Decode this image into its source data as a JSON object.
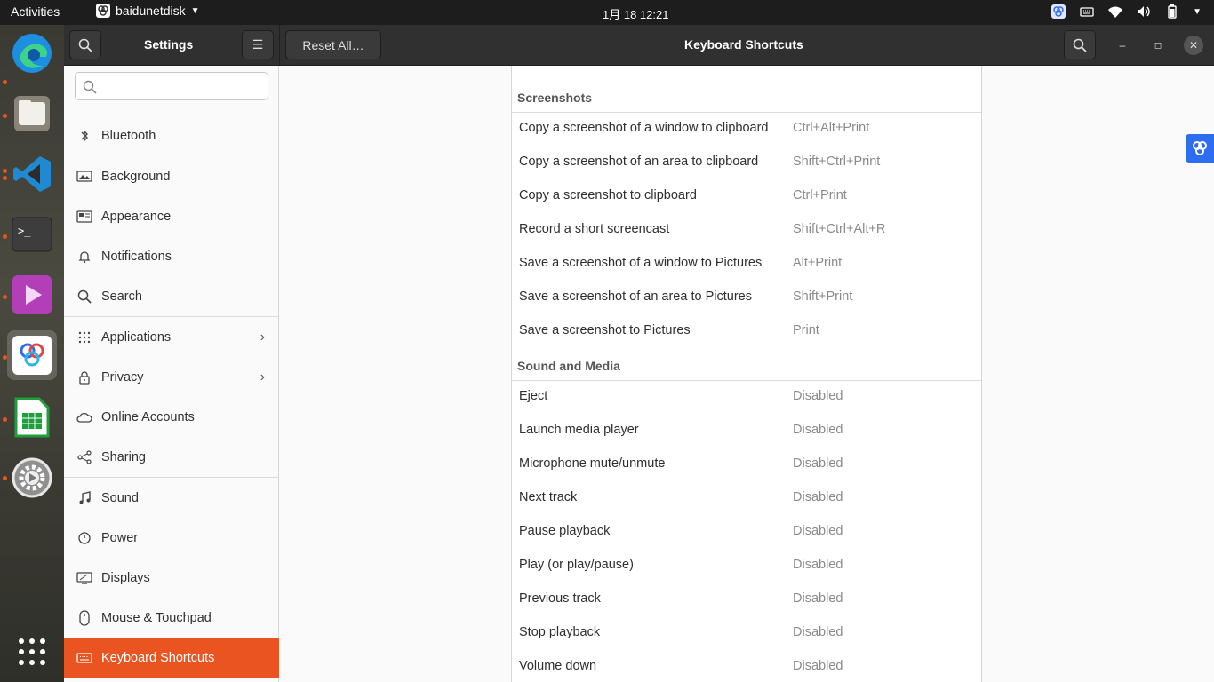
{
  "topbar": {
    "activities": "Activities",
    "app_name": "baidunetdisk",
    "clock": "1月 18  12:21"
  },
  "dock": {
    "apps": [
      "microsoft-edge",
      "files",
      "visual-studio-code",
      "terminal",
      "video-player",
      "baidunetdisk",
      "libreoffice-calc",
      "settings",
      "show-applications"
    ]
  },
  "header": {
    "settings_title": "Settings",
    "reset_label": "Reset All…",
    "title": "Keyboard Shortcuts"
  },
  "sidebar": {
    "search_placeholder": "",
    "items": [
      {
        "label": "Bluetooth",
        "icon": "bluetooth-icon"
      },
      {
        "label": "Background",
        "icon": "background-icon"
      },
      {
        "label": "Appearance",
        "icon": "appearance-icon"
      },
      {
        "label": "Notifications",
        "icon": "bell-icon"
      },
      {
        "label": "Search",
        "icon": "search-icon"
      },
      {
        "label": "Applications",
        "icon": "grid-icon"
      },
      {
        "label": "Privacy",
        "icon": "lock-icon"
      },
      {
        "label": "Online Accounts",
        "icon": "cloud-icon"
      },
      {
        "label": "Sharing",
        "icon": "share-icon"
      },
      {
        "label": "Sound",
        "icon": "music-note-icon"
      },
      {
        "label": "Power",
        "icon": "power-icon"
      },
      {
        "label": "Displays",
        "icon": "display-icon"
      },
      {
        "label": "Mouse & Touchpad",
        "icon": "mouse-icon"
      },
      {
        "label": "Keyboard Shortcuts",
        "icon": "keyboard-icon"
      }
    ]
  },
  "sections": [
    {
      "title": "Screenshots",
      "rows": [
        {
          "name": "Copy a screenshot of a window to clipboard",
          "accel": "Ctrl+Alt+Print"
        },
        {
          "name": "Copy a screenshot of an area to clipboard",
          "accel": "Shift+Ctrl+Print"
        },
        {
          "name": "Copy a screenshot to clipboard",
          "accel": "Ctrl+Print"
        },
        {
          "name": "Record a short screencast",
          "accel": "Shift+Ctrl+Alt+R"
        },
        {
          "name": "Save a screenshot of a window to Pictures",
          "accel": "Alt+Print"
        },
        {
          "name": "Save a screenshot of an area to Pictures",
          "accel": "Shift+Print"
        },
        {
          "name": "Save a screenshot to Pictures",
          "accel": "Print"
        }
      ]
    },
    {
      "title": "Sound and Media",
      "rows": [
        {
          "name": "Eject",
          "accel": "Disabled"
        },
        {
          "name": "Launch media player",
          "accel": "Disabled"
        },
        {
          "name": "Microphone mute/unmute",
          "accel": "Disabled"
        },
        {
          "name": "Next track",
          "accel": "Disabled"
        },
        {
          "name": "Pause playback",
          "accel": "Disabled"
        },
        {
          "name": "Play (or play/pause)",
          "accel": "Disabled"
        },
        {
          "name": "Previous track",
          "accel": "Disabled"
        },
        {
          "name": "Stop playback",
          "accel": "Disabled"
        },
        {
          "name": "Volume down",
          "accel": "Disabled"
        }
      ]
    }
  ],
  "colors": {
    "accent": "#e95420",
    "header": "#303030",
    "floating_widget": "#2f6df0"
  }
}
